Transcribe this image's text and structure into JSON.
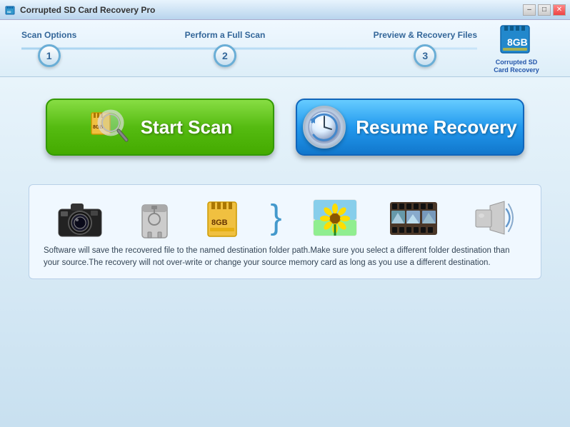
{
  "window": {
    "title": "Corrupted SD Card Recovery Pro",
    "controls": {
      "minimize": "–",
      "maximize": "□",
      "close": "✕"
    }
  },
  "steps": [
    {
      "label": "Scan Options",
      "number": "1"
    },
    {
      "label": "Perform a Full Scan",
      "number": "2"
    },
    {
      "label": "Preview & Recovery Files",
      "number": "3"
    }
  ],
  "logo": {
    "text": "Corrupted SD\nCard Recovery"
  },
  "buttons": {
    "start_scan": "Start Scan",
    "resume_recovery": "Resume Recovery"
  },
  "info_text": "Software will save the recovered file to the named destination folder path.Make sure you select a different folder destination than your source.The recovery will not over-write or change your source memory card as long as you use a different destination.",
  "icons": [
    "camera",
    "usb",
    "sdcard",
    "bracket",
    "photos",
    "film",
    "music"
  ]
}
